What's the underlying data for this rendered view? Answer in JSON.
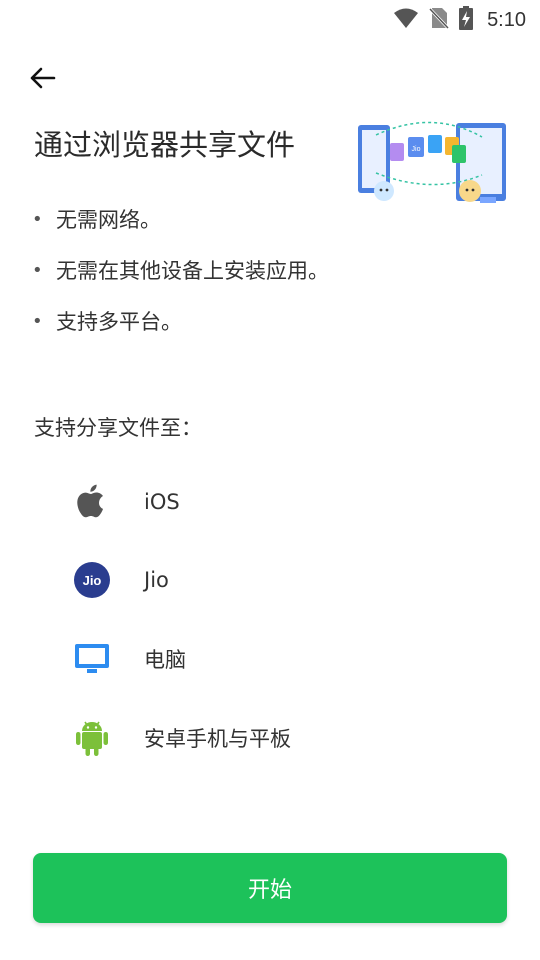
{
  "status": {
    "time": "5:10"
  },
  "header": {
    "title": "通过浏览器共享文件"
  },
  "hero": {
    "badge_text": "Jio"
  },
  "bullets": [
    {
      "marker": "•",
      "text": "无需网络。"
    },
    {
      "marker": "•",
      "text": "无需在其他设备上安装应用。"
    },
    {
      "marker": "•",
      "text": "支持多平台。"
    }
  ],
  "platforms_section": {
    "title": "支持分享文件至：",
    "items": [
      {
        "icon": "apple-icon",
        "label": "iOS"
      },
      {
        "icon": "jio-icon",
        "icon_text": "Jio",
        "label": "Jio"
      },
      {
        "icon": "monitor-icon",
        "label": "电脑"
      },
      {
        "icon": "android-icon",
        "label": "安卓手机与平板"
      }
    ]
  },
  "action": {
    "start_label": "开始"
  },
  "colors": {
    "primary": "#1dc25a",
    "jio_blue": "#2a3d8f",
    "monitor_blue": "#2d8cf0",
    "android_green": "#7cc03a"
  }
}
